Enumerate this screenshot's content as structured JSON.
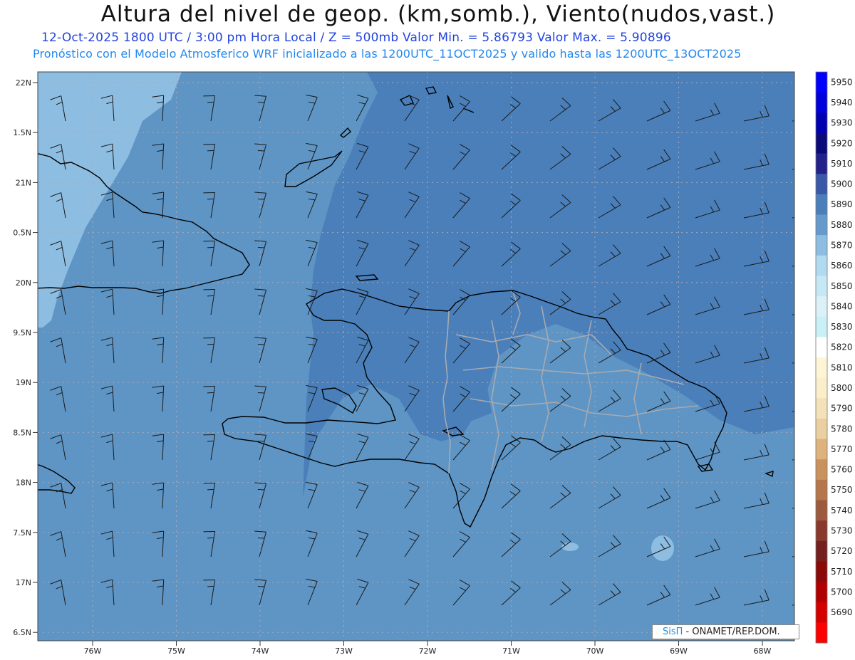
{
  "header": {
    "title": "Altura del nivel de geop. (km,somb.), Viento(nudos,vast.)",
    "subtitle1": "12-Oct-2025   1800 UTC / 3:00 pm Hora Local / Z = 500mb     Valor Min. = 5.86793  Valor Max. = 5.90896",
    "subtitle2": "Pronóstico con el Modelo Atmosferico WRF inicializado a las 1200UTC_11OCT2025 y valido hasta las  1200UTC_13OCT2025"
  },
  "map": {
    "lat_labels": [
      "22N",
      "1.5N",
      "21N",
      "0.5N",
      "20N",
      "9.5N",
      "19N",
      "8.5N",
      "18N",
      "7.5N",
      "17N",
      "6.5N"
    ],
    "lon_labels": [
      "76W",
      "75W",
      "74W",
      "73W",
      "72W",
      "71W",
      "70W",
      "69W",
      "68W"
    ],
    "colors": {
      "field_main": "#5e95c5",
      "field_high": "#4a7fba",
      "field_low": "#8dbde0"
    }
  },
  "colorbar": {
    "levels": [
      "5950",
      "5940",
      "5930",
      "5920",
      "5910",
      "5900",
      "5890",
      "5880",
      "5870",
      "5860",
      "5850",
      "5840",
      "5830",
      "5820",
      "5810",
      "5800",
      "5790",
      "5780",
      "5770",
      "5760",
      "5750",
      "5740",
      "5730",
      "5720",
      "5710",
      "5700",
      "5690"
    ],
    "colors": [
      "#0000ff",
      "#0000dd",
      "#0000b0",
      "#0a0a7a",
      "#22228a",
      "#3a58a8",
      "#4a7fba",
      "#6699cc",
      "#8dbde0",
      "#b0daf0",
      "#c6e8f4",
      "#daf1f8",
      "#c8f0f6",
      "#ffffff",
      "#fdf5d6",
      "#faeecb",
      "#f3e1b8",
      "#eacfa0",
      "#ddb27c",
      "#c9925d",
      "#b4764a",
      "#9e5a3d",
      "#8a3a2c",
      "#75201e",
      "#8a0a0a",
      "#b00000",
      "#d40000",
      "#ff0000"
    ]
  },
  "credit": {
    "part1": "SisΠ",
    "part2": " - ONAMET/REP.DOM."
  }
}
